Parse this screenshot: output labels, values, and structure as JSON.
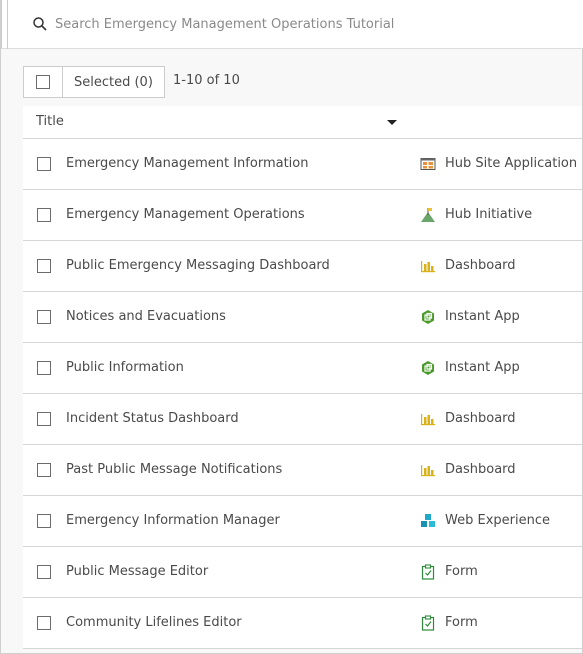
{
  "search": {
    "placeholder": "Search Emergency Management Operations Tutorial",
    "value": ""
  },
  "toolbar": {
    "selected_label": "Selected (0)",
    "count_label": "1-10 of 10"
  },
  "table": {
    "column_title": "Title",
    "rows": [
      {
        "title": "Emergency Management Information",
        "type": "Hub Site Application",
        "icon": "hub-site-application-icon"
      },
      {
        "title": "Emergency Management Operations",
        "type": "Hub Initiative",
        "icon": "hub-initiative-icon"
      },
      {
        "title": "Public Emergency Messaging Dashboard",
        "type": "Dashboard",
        "icon": "dashboard-icon"
      },
      {
        "title": "Notices and Evacuations",
        "type": "Instant App",
        "icon": "instant-app-icon"
      },
      {
        "title": "Public Information",
        "type": "Instant App",
        "icon": "instant-app-icon"
      },
      {
        "title": "Incident Status Dashboard",
        "type": "Dashboard",
        "icon": "dashboard-icon"
      },
      {
        "title": "Past Public Message Notifications",
        "type": "Dashboard",
        "icon": "dashboard-icon"
      },
      {
        "title": "Emergency Information Manager",
        "type": "Web Experience",
        "icon": "web-experience-icon"
      },
      {
        "title": "Public Message Editor",
        "type": "Form",
        "icon": "form-icon"
      },
      {
        "title": "Community Lifelines Editor",
        "type": "Form",
        "icon": "form-icon"
      }
    ]
  }
}
